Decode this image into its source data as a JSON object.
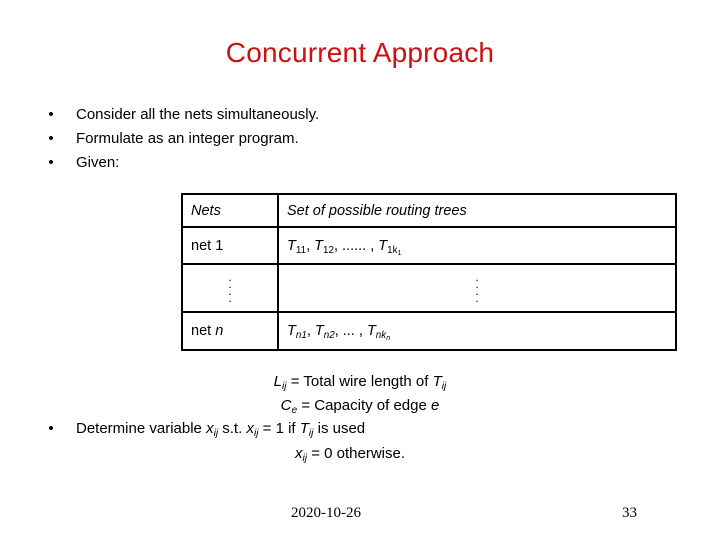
{
  "slide": {
    "title": "Concurrent Approach",
    "title_color": "#cc1111",
    "bullet_marker": "•",
    "bullets": [
      "Consider all the nets simultaneously.",
      "Formulate as an integer program.",
      "Given:"
    ],
    "table": {
      "headers": [
        "Nets",
        "Set of possible routing trees"
      ],
      "rows": [
        {
          "net": "net 1",
          "net_plain": "net ",
          "net_var": "1",
          "trees_plain": "T11, T12, ...... , T1k1",
          "trees_parts": {
            "t1_base": "T",
            "t1_sub": "11",
            "t2_base": "T",
            "t2_sub": "12",
            "ellipsis": "...... ,",
            "t3_base": "T",
            "t3_sub": "1k",
            "t3_subsub": "1"
          }
        },
        {
          "net": "⋮",
          "trees_plain": "⋮",
          "dots": "⋮"
        },
        {
          "net": "net n",
          "net_plain": "net ",
          "net_var": "n",
          "trees_plain": "Tn1, Tn2, ... , Tnkn",
          "trees_parts": {
            "t1_base": "T",
            "t1_sub": "n1",
            "t2_base": "T",
            "t2_sub": "n2",
            "ellipsis": "... ,",
            "t3_base": "T",
            "t3_sub": "nk",
            "t3_subsub": "n"
          }
        }
      ]
    },
    "definitions": [
      {
        "sym": "L",
        "sym_sub": "ij",
        "text": " = Total wire length of ",
        "tail_sym": "T",
        "tail_sub": "ij",
        "plain": "Lij = Total wire length of Tij"
      },
      {
        "sym": "C",
        "sym_sub": "e",
        "text": " = Capacity of edge ",
        "tail_sym": "e",
        "tail_sub": "",
        "plain": "Ce = Capacity of edge e"
      }
    ],
    "last_bullet": {
      "line1_plain": "Determine variable xij s.t. xij = 1 if Tij is used",
      "lead": "Determine variable ",
      "x1": "x",
      "x1_sub": "ij",
      "mid1": " s.t. ",
      "x2": "x",
      "x2_sub": "ij",
      "mid2": " = 1 if ",
      "t1": "T",
      "t1_sub": "ij",
      "tail": " is used",
      "line2_plain": "xij = 0 otherwise.",
      "x3": "x",
      "x3_sub": "ij",
      "line2_tail": " = 0 otherwise."
    },
    "footer": {
      "date": "2020-10-26",
      "page_number": "33"
    }
  }
}
